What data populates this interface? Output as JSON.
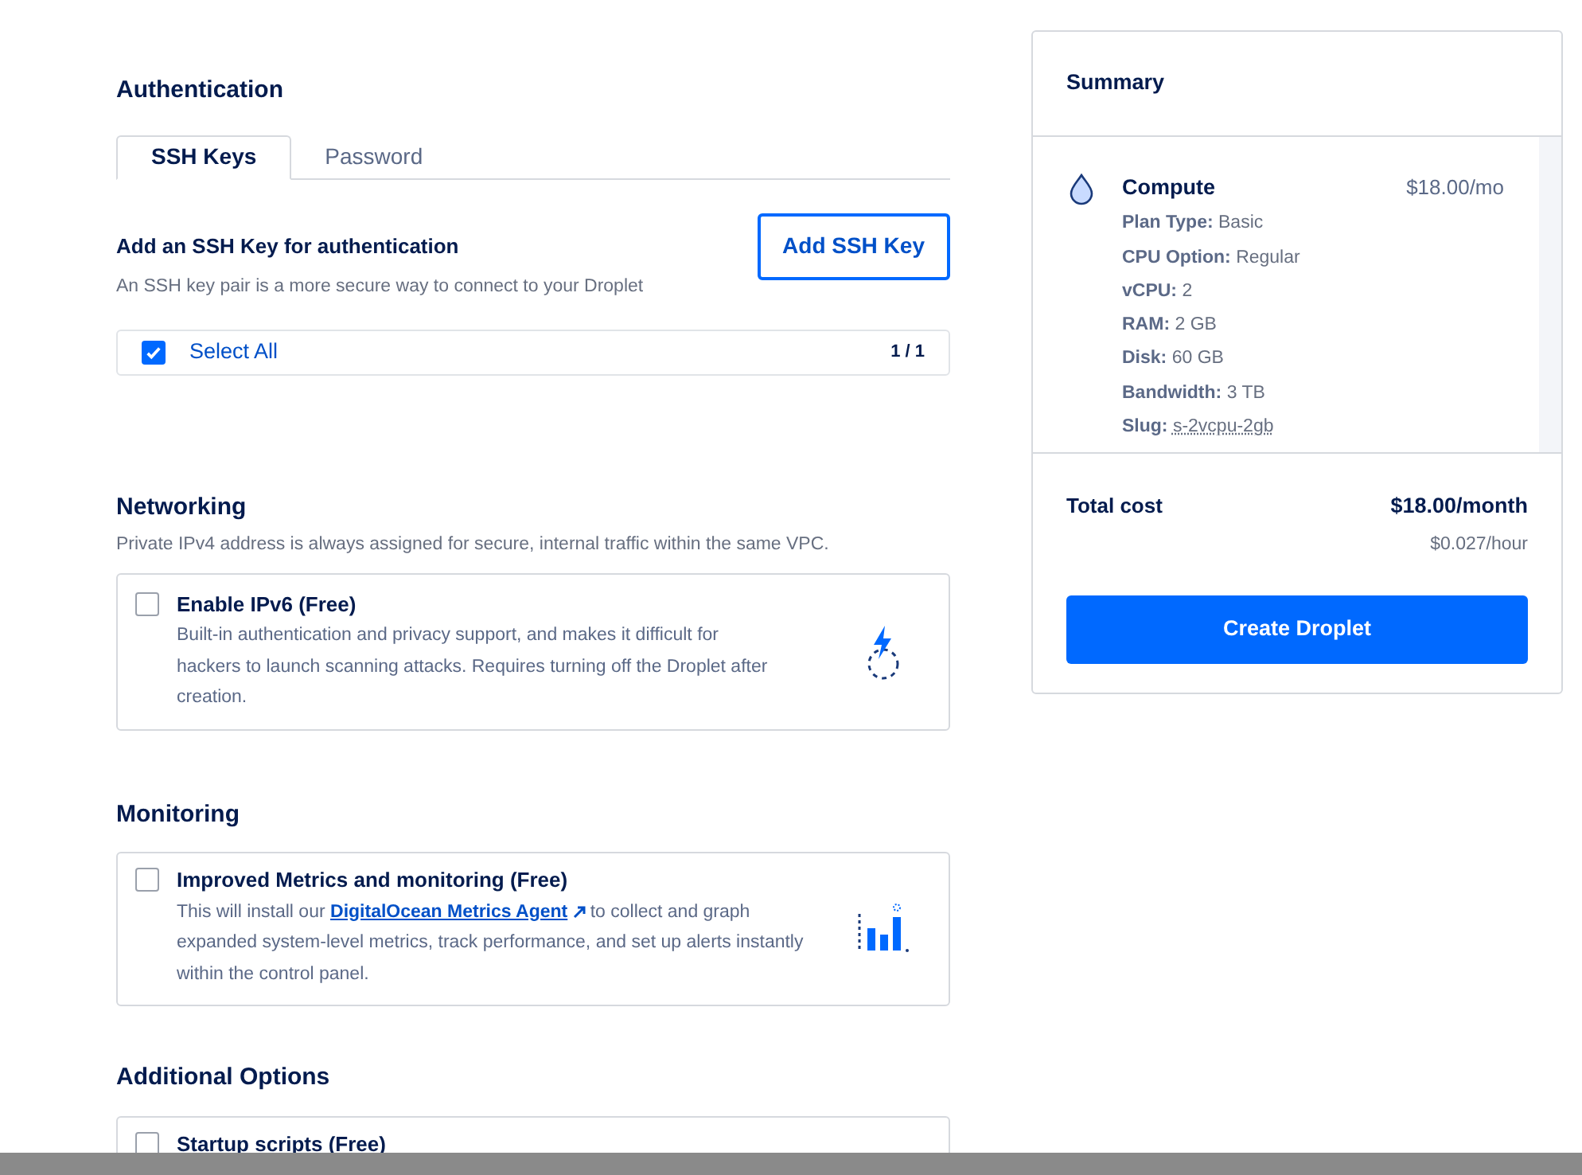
{
  "authentication": {
    "title": "Authentication",
    "tabs": [
      {
        "label": "SSH Keys",
        "selected": true
      },
      {
        "label": "Password",
        "selected": false
      }
    ],
    "ssh": {
      "heading": "Add an SSH Key for authentication",
      "description": "An SSH key pair is a more secure way to connect to your Droplet",
      "button": "Add SSH Key",
      "select_all": {
        "label": "Select All",
        "checked": true,
        "count": "1 / 1"
      }
    }
  },
  "sections": [
    {
      "title": "Networking",
      "description": "Private IPv4 address is always assigned for secure, internal traffic within the same VPC.",
      "option": {
        "label": "Enable IPv6 (Free)",
        "checked": false,
        "kind": "ipv6",
        "text": "Built-in authentication and privacy support, and makes it difficult for hackers to launch scanning attacks. Requires turning off the Droplet after creation."
      }
    },
    {
      "title": "Monitoring",
      "option": {
        "label": "Improved Metrics and monitoring (Free)",
        "checked": false,
        "kind": "metrics",
        "text_before": "This will install our",
        "link": "DigitalOcean Metrics Agent",
        "text_after": "to collect and graph expanded system-level metrics, track performance, and set up alerts instantly within the control panel."
      }
    },
    {
      "title": "Additional Options",
      "option": {
        "label": "Startup scripts (Free)",
        "checked": false,
        "kind": "plain"
      }
    }
  ],
  "summary": {
    "title": "Summary",
    "item": {
      "name": "Compute",
      "price": "$18.00/mo",
      "specs": [
        {
          "label": "Plan Type:",
          "value": "Basic"
        },
        {
          "label": "CPU Option:",
          "value": "Regular"
        },
        {
          "label": "vCPU:",
          "value": "2"
        },
        {
          "label": "RAM:",
          "value": "2 GB"
        },
        {
          "label": "Disk:",
          "value": "60 GB"
        },
        {
          "label": "Bandwidth:",
          "value": "3 TB"
        },
        {
          "label": "Slug:",
          "value": "s-2vcpu-2gb",
          "kind": "underlined"
        }
      ]
    },
    "total_label": "Total cost",
    "total": "$18.00/month",
    "hourly": "$0.027/hour",
    "button": "Create Droplet"
  }
}
